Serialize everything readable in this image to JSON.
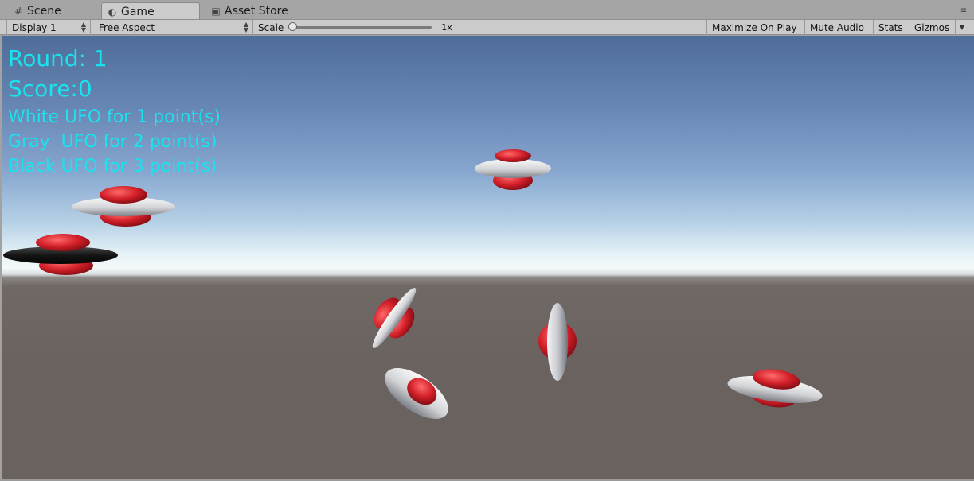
{
  "tabs": [
    {
      "label": "Scene",
      "icon": "grid-icon"
    },
    {
      "label": "Game",
      "icon": "pacman-icon"
    },
    {
      "label": "Asset Store",
      "icon": "bag-icon"
    }
  ],
  "toolbar": {
    "display": "Display 1",
    "aspect": "Free Aspect",
    "scale_label": "Scale",
    "scale_value": "1x",
    "maximize": "Maximize On Play",
    "mute": "Mute Audio",
    "stats": "Stats",
    "gizmos": "Gizmos"
  },
  "hud": {
    "round": "Round: 1",
    "score": "Score:0",
    "line1": "White UFO for 1 point(s)",
    "line2": "Gray  UFO for 2 point(s)",
    "line3": "Black UFO for 3 point(s)"
  },
  "colors": {
    "hud_text": "#19e3ee",
    "ufo_dome": "#c8202a",
    "ufo_white": "#e4e4e6",
    "ufo_black": "#1a1a1a"
  }
}
